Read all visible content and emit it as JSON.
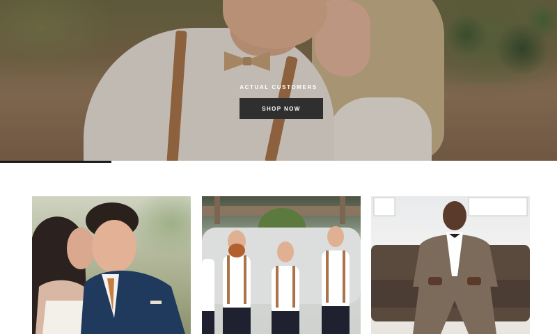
{
  "hero": {
    "caption": "ACTUAL CUSTOMERS",
    "button_label": "SHOP NOW",
    "image_alt": "Couple embracing outdoors, groom in suspenders and bow tie"
  },
  "carousel": {
    "progress": 0.2
  },
  "gallery": {
    "tiles": [
      {
        "alt": "Bride kissing groom in navy suit"
      },
      {
        "alt": "Groomsmen in white shirts and suspenders"
      },
      {
        "alt": "Man in taupe suit seated on leather sofa"
      }
    ]
  },
  "colors": {
    "button_bg": "#2f2f2f",
    "button_text": "#ffffff",
    "progress": "#1a1a1a",
    "page_bg": "#ffffff"
  }
}
